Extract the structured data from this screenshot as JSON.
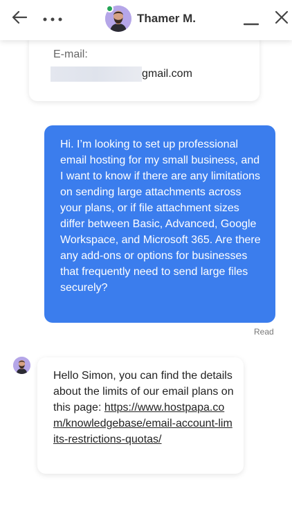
{
  "header": {
    "agent_name": "Thamer M.",
    "status_color": "#23a455",
    "icons": {
      "back": "arrow-left-icon",
      "more": "more-horizontal-icon",
      "minimize": "minimize-icon",
      "close": "close-icon"
    }
  },
  "form_card": {
    "email_label": "E-mail:",
    "email_suffix": "gmail.com"
  },
  "messages": {
    "user_text": "Hi. I’m looking to set up professional email hosting for my small business, and I want to know if there are any limitations on sending large attachments across your plans, or if file attachment sizes differ between Basic, Advanced, Google Workspace, and Microsoft 365. Are there any add-ons or options for businesses that frequently need to send large files securely?",
    "read_status": "Read",
    "agent_text": "Hello Simon, you can find the details about the limits of our email plans on this page:",
    "agent_link": "https://www.hostpapa.com/knowledgebase/email-account-limits-restrictions-quotas/"
  },
  "colors": {
    "accent": "#3b7ded",
    "avatar_bg": "#b5a6e8"
  }
}
